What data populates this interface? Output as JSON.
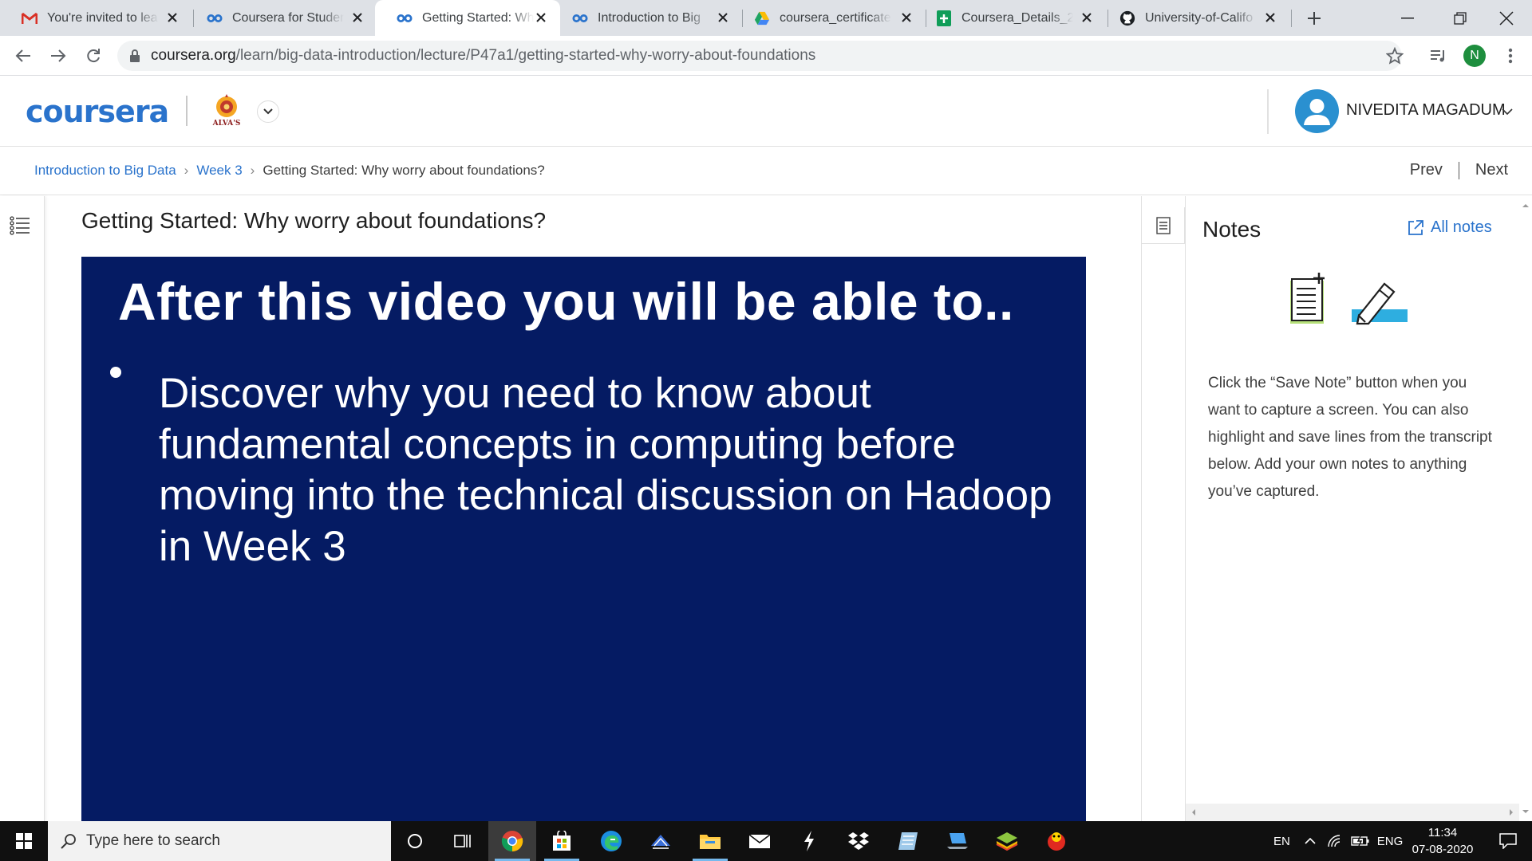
{
  "browser": {
    "tabs": [
      {
        "label": "You're invited to lea",
        "icon": "gmail-icon"
      },
      {
        "label": "Coursera for Studen",
        "icon": "coursera-icon"
      },
      {
        "label": "Getting Started: Wh",
        "icon": "coursera-icon",
        "active": true
      },
      {
        "label": "Introduction to Big",
        "icon": "coursera-icon"
      },
      {
        "label": "coursera_certificate",
        "icon": "google-drive-icon"
      },
      {
        "label": "Coursera_Details_2r",
        "icon": "google-sheets-icon"
      },
      {
        "label": "University-of-Califo",
        "icon": "github-icon"
      }
    ],
    "url_host": "coursera.org",
    "url_path": "/learn/big-data-introduction/lecture/P47a1/getting-started-why-worry-about-foundations",
    "profile_initial": "N"
  },
  "header": {
    "logo_text": "coursera",
    "partner_logo_text": "ALVA'S",
    "user_name": "NIVEDITA MAGADUM"
  },
  "breadcrumb": {
    "course": "Introduction to Big Data",
    "week": "Week 3",
    "current": "Getting Started: Why worry about foundations?",
    "separator": "›"
  },
  "nav": {
    "prev": "Prev",
    "next": "Next"
  },
  "lecture": {
    "title": "Getting Started: Why worry about foundations?",
    "slide_title": "After this video you will be able to..",
    "slide_bullet": "Discover why you need to know about fundamental concepts in computing before moving into the technical discussion on Hadoop in Week 3"
  },
  "notes": {
    "title": "Notes",
    "all_notes": "All notes",
    "help": "Click the “Save Note” button when you want to capture a screen. You can also highlight and save lines from the transcript below. Add your own notes to anything you’ve captured."
  },
  "taskbar": {
    "search_placeholder": "Type here to search",
    "lang_short": "EN",
    "lang": "ENG",
    "time": "11:34",
    "date": "07-08-2020"
  },
  "colors": {
    "coursera_blue": "#2a73cc",
    "slide_background": "#051b63",
    "avatar_blue": "#2a90d0"
  }
}
